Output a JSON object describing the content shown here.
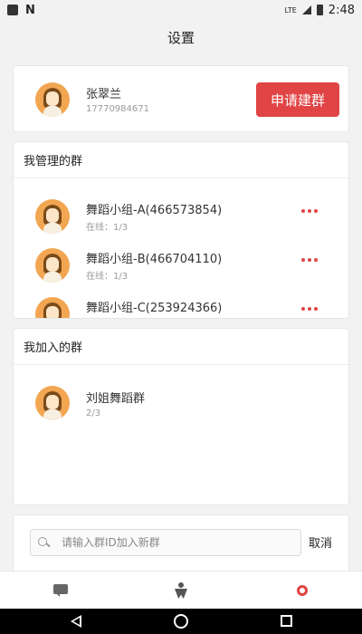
{
  "status_bar": {
    "network": "LTE",
    "time": "2:48"
  },
  "header": {
    "title": "设置"
  },
  "profile": {
    "name": "张翠兰",
    "phone": "17770984671",
    "apply_button": "申请建群"
  },
  "managed_groups": {
    "title": "我管理的群",
    "items": [
      {
        "name": "舞蹈小组-A(466573854)",
        "status": "在线：1/3"
      },
      {
        "name": "舞蹈小组-B(466704110)",
        "status": "在线：1/3"
      },
      {
        "name": "舞蹈小组-C(253924366)",
        "status": ""
      }
    ]
  },
  "joined_groups": {
    "title": "我加入的群",
    "items": [
      {
        "name": "刘姐舞蹈群",
        "status": "2/3"
      }
    ]
  },
  "search": {
    "placeholder": "请输入群ID加入新群",
    "value": "",
    "cancel_label": "取消"
  },
  "tab_bar": {
    "tabs": [
      {
        "icon": "chat-icon"
      },
      {
        "icon": "person-icon"
      },
      {
        "icon": "gear-icon",
        "active": true
      }
    ],
    "accent_color": "#e04444"
  },
  "colors": {
    "accent": "#e04444",
    "avatar_bg": "#f2a652"
  }
}
